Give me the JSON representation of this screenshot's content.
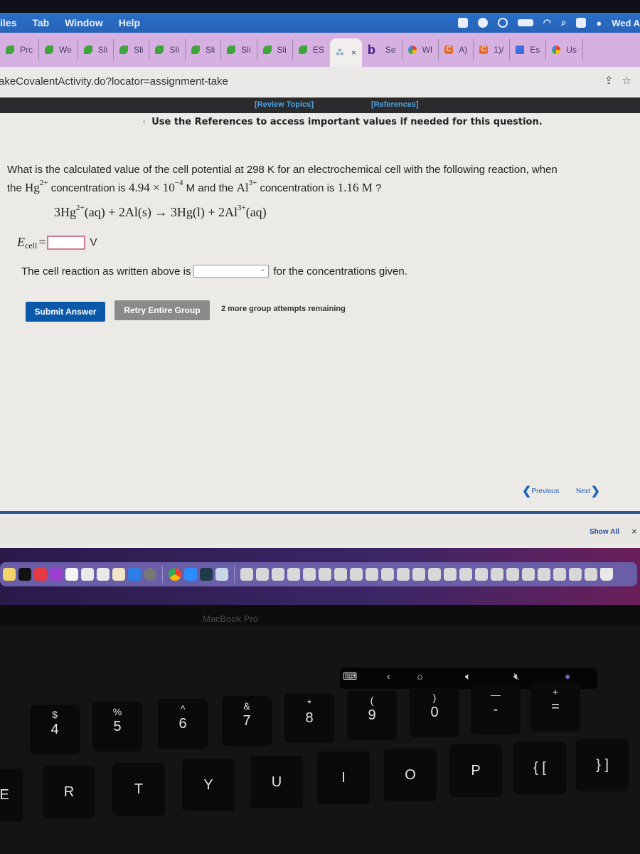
{
  "menubar": {
    "items": [
      "iles",
      "Tab",
      "Window",
      "Help"
    ],
    "clock": "Wed A"
  },
  "tabs": [
    {
      "label": "Prc",
      "icon": "cengage-leaf-icon"
    },
    {
      "label": "We",
      "icon": "cengage-leaf-icon"
    },
    {
      "label": "Sli",
      "icon": "cengage-leaf-icon"
    },
    {
      "label": "Sli",
      "icon": "cengage-leaf-icon"
    },
    {
      "label": "Sli",
      "icon": "cengage-leaf-icon"
    },
    {
      "label": "Sli",
      "icon": "cengage-leaf-icon"
    },
    {
      "label": "Sli",
      "icon": "cengage-leaf-icon"
    },
    {
      "label": "Sli",
      "icon": "cengage-leaf-icon"
    },
    {
      "label": "ES",
      "icon": "cengage-leaf-icon"
    },
    {
      "label": "×",
      "icon": "loading-spinner-icon",
      "active": true
    },
    {
      "label": "Se",
      "icon": "bing-b-icon"
    },
    {
      "label": "WI",
      "icon": "google-icon"
    },
    {
      "label": "A)",
      "icon": "chegg-c-icon"
    },
    {
      "label": "1)/",
      "icon": "chegg-c-icon"
    },
    {
      "label": "Es",
      "icon": "docs-icon"
    },
    {
      "label": "Us",
      "icon": "google-icon"
    }
  ],
  "address": {
    "url": "akeCovalentActivity.do?locator=assignment-take",
    "share_icon": "⇪",
    "star_icon": "☆"
  },
  "links": {
    "review_topics": "[Review Topics]",
    "references": "[References]"
  },
  "instruction": "Use the References to access important values if needed for this question.",
  "question": {
    "line1": "What is the calculated value of the cell potential at 298 K for an electrochemical cell with the following reaction, when",
    "the": "the",
    "hg": "Hg",
    "hg_charge": "2+",
    "mid1": "concentration is",
    "hg_conc": "4.94 × 10",
    "hg_exp": "−4",
    "mid2": "M and the",
    "al": "Al",
    "al_charge": "3+",
    "mid3": "concentration is",
    "al_conc": "1.16 M",
    "end": "?"
  },
  "reaction": {
    "part1": "3Hg",
    "charge1": "2+",
    "part2": "(aq) + 2Al(s) → 3Hg(l) + 2Al",
    "charge2": "3+",
    "part3": "(aq)"
  },
  "ecell": {
    "label": "E",
    "sub": "cell",
    "equals": "=",
    "value": "",
    "unit": "V"
  },
  "spontaneity": {
    "prefix": "The cell reaction as written above is",
    "selected": "",
    "suffix": "for the concentrations given."
  },
  "buttons": {
    "submit": "Submit Answer",
    "retry": "Retry Entire Group"
  },
  "attempts": "2 more group attempts remaining",
  "nav": {
    "previous": "Previous",
    "next": "Next"
  },
  "downloads": {
    "show_all": "Show All",
    "close": "×"
  },
  "laptop": {
    "brand": "MacBook Pro"
  },
  "keyboard": {
    "number_row": [
      {
        "top": "$",
        "bottom": "4"
      },
      {
        "top": "%",
        "bottom": "5"
      },
      {
        "top": "^",
        "bottom": "6"
      },
      {
        "top": "&",
        "bottom": "7"
      },
      {
        "top": "*",
        "bottom": "8"
      },
      {
        "top": "(",
        "bottom": "9"
      },
      {
        "top": ")",
        "bottom": "0"
      },
      {
        "top": "—",
        "bottom": "-"
      },
      {
        "top": "+",
        "bottom": "="
      }
    ],
    "letter_row": [
      "E",
      "R",
      "T",
      "Y",
      "U",
      "I",
      "O",
      "P",
      "{ [",
      "} ]"
    ]
  }
}
